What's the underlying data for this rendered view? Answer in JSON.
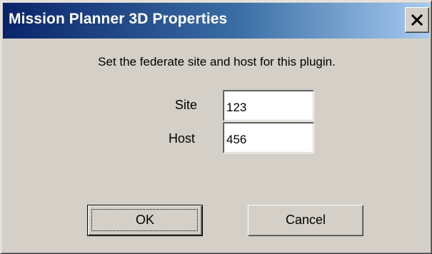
{
  "window": {
    "title": "Mission Planner 3D Properties",
    "close_icon": "close-icon"
  },
  "prompt": "Set the federate site and host for this plugin.",
  "fields": {
    "site": {
      "label": "Site",
      "value": "123"
    },
    "host": {
      "label": "Host",
      "value": "456"
    }
  },
  "buttons": {
    "ok_label": "OK",
    "cancel_label": "Cancel"
  },
  "colors": {
    "face": "#d4d0c8",
    "title_start": "#0a246a",
    "title_end": "#a6caf0"
  }
}
